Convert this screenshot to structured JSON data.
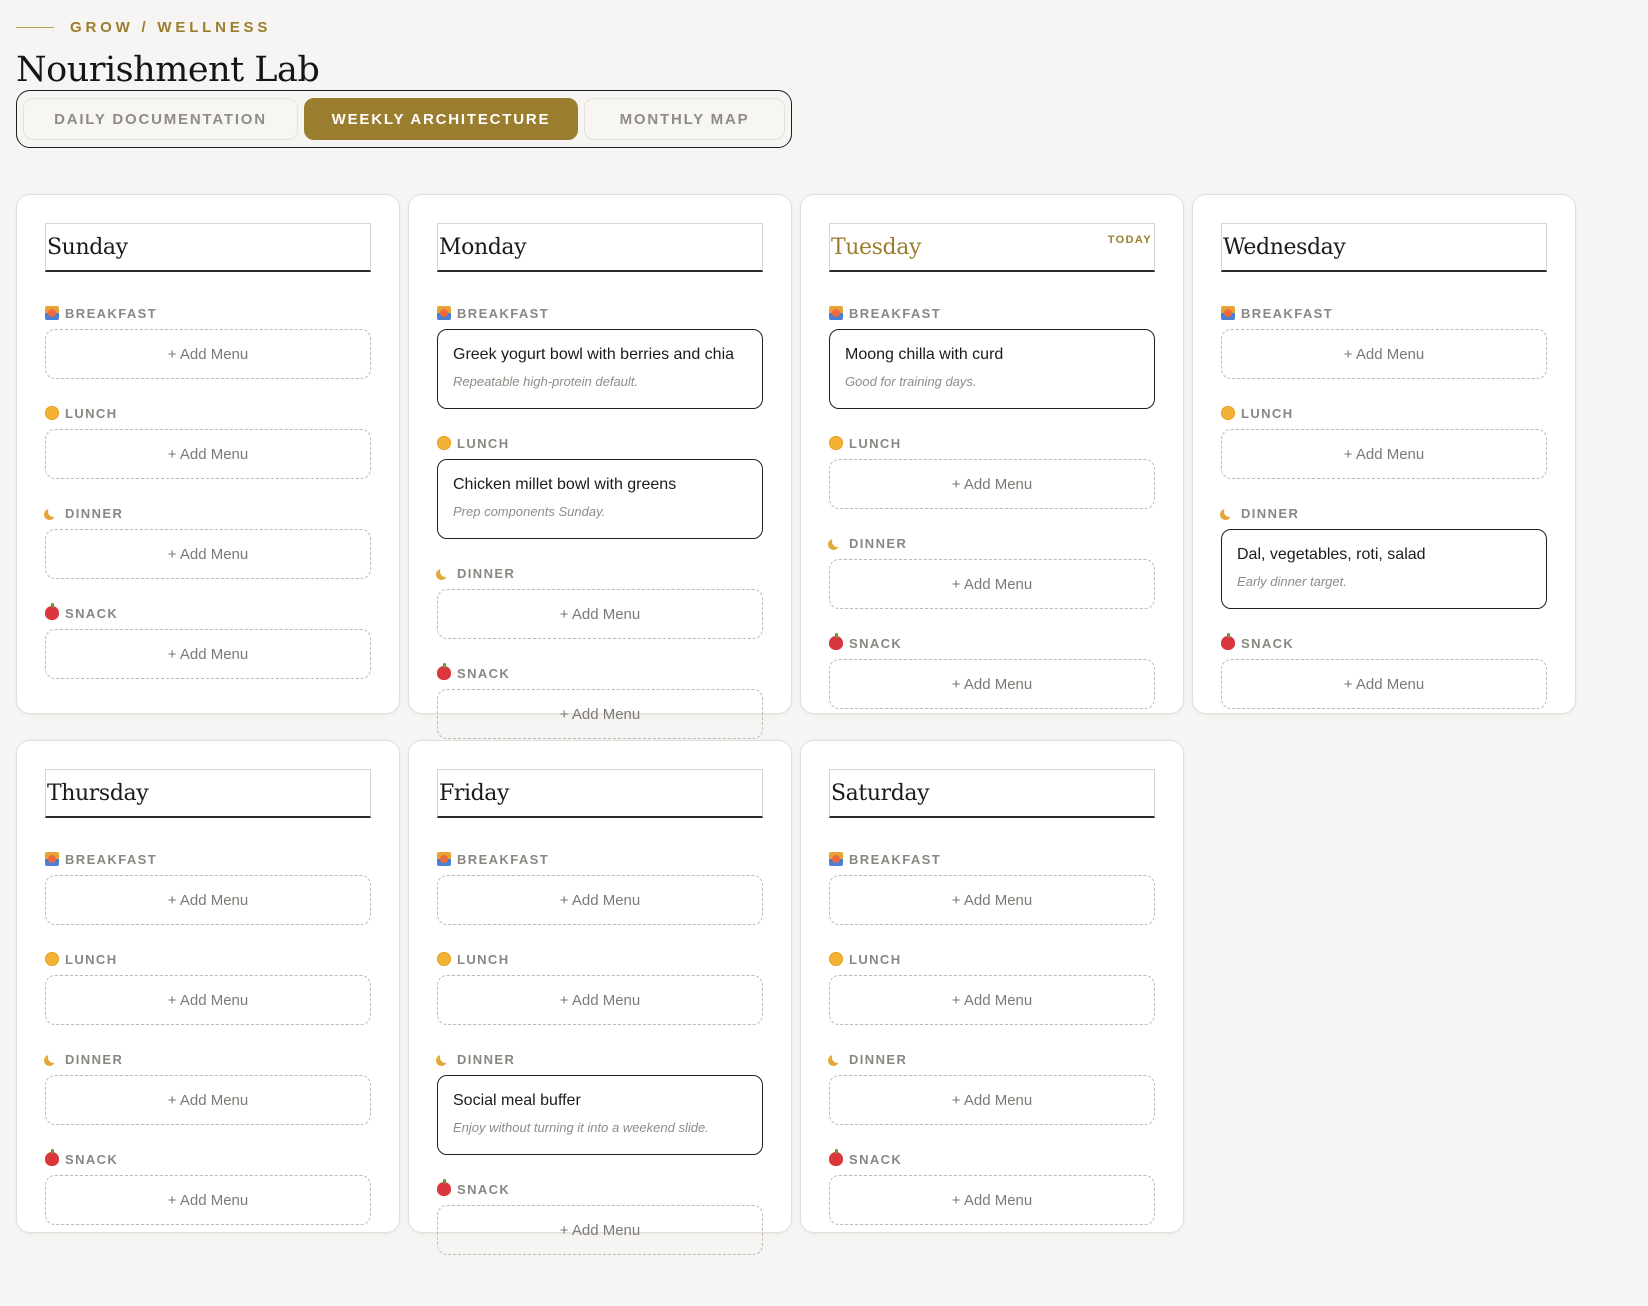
{
  "breadcrumb": "GROW / WELLNESS",
  "title": "Nourishment Lab",
  "tabs": [
    {
      "label": "DAILY DOCUMENTATION",
      "active": false
    },
    {
      "label": "WEEKLY ARCHITECTURE",
      "active": true
    },
    {
      "label": "MONTHLY MAP",
      "active": false
    }
  ],
  "add_label": "+ Add Menu",
  "today_label": "TODAY",
  "meal_types": [
    {
      "label": "BREAKFAST",
      "icon": "sunrise-icon"
    },
    {
      "label": "LUNCH",
      "icon": "sun-icon"
    },
    {
      "label": "DINNER",
      "icon": "moon-icon"
    },
    {
      "label": "SNACK",
      "icon": "apple-icon"
    }
  ],
  "days": [
    {
      "name": "Sunday",
      "today": false,
      "meals": [
        null,
        null,
        null,
        null
      ]
    },
    {
      "name": "Monday",
      "today": false,
      "meals": [
        {
          "title": "Greek yogurt bowl with berries and chia",
          "note": "Repeatable high-protein default."
        },
        {
          "title": "Chicken millet bowl with greens",
          "note": "Prep components Sunday."
        },
        null,
        null
      ]
    },
    {
      "name": "Tuesday",
      "today": true,
      "meals": [
        {
          "title": "Moong chilla with curd",
          "note": "Good for training days."
        },
        null,
        null,
        null
      ]
    },
    {
      "name": "Wednesday",
      "today": false,
      "meals": [
        null,
        null,
        {
          "title": "Dal, vegetables, roti, salad",
          "note": "Early dinner target."
        },
        null
      ]
    },
    {
      "name": "Thursday",
      "today": false,
      "meals": [
        null,
        null,
        null,
        null
      ]
    },
    {
      "name": "Friday",
      "today": false,
      "meals": [
        null,
        null,
        {
          "title": "Social meal buffer",
          "note": "Enjoy without turning it into a weekend slide."
        },
        null
      ]
    },
    {
      "name": "Saturday",
      "today": false,
      "meals": [
        null,
        null,
        null,
        null
      ]
    }
  ]
}
